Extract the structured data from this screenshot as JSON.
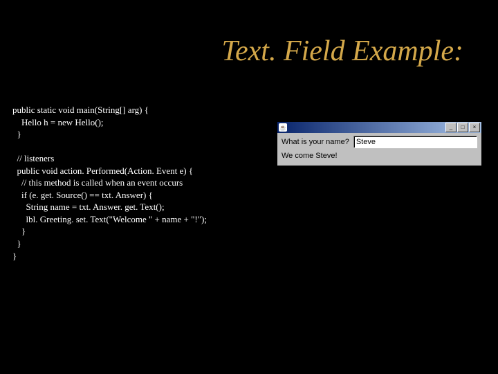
{
  "title": "Text. Field Example:",
  "code": "public static void main(String[] arg) {\n    Hello h = new Hello();\n  }\n\n  // listeners\n  public void action. Performed(Action. Event e) {\n    // this method is called when an event occurs\n    if (e. get. Source() == txt. Answer) {\n      String name = txt. Answer. get. Text();\n      lbl. Greeting. set. Text(\"Welcome \" + name + \"!\");\n    }\n  }\n}",
  "window": {
    "java_icon": "☕",
    "title": "",
    "buttons": {
      "minimize": "_",
      "maximize": "□",
      "close": "×"
    },
    "prompt": "What is your name?",
    "input_value": "Steve",
    "greeting": "We come Steve!"
  }
}
